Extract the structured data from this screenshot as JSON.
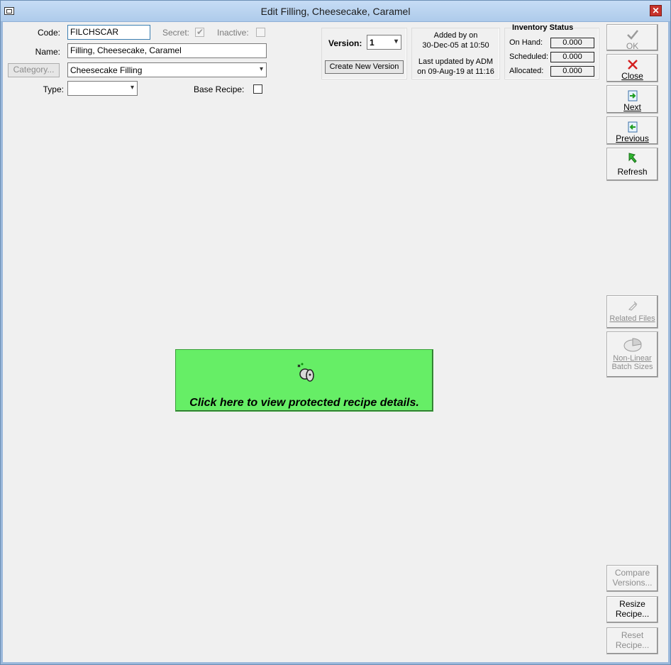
{
  "window": {
    "title": "Edit Filling, Cheesecake, Caramel"
  },
  "form": {
    "code_label": "Code:",
    "code_value": "FILCHSCAR",
    "secret_label": "Secret:",
    "inactive_label": "Inactive:",
    "name_label": "Name:",
    "name_value": "Filling, Cheesecake, Caramel",
    "category_button": "Category...",
    "category_value": "Cheesecake Filling",
    "type_label": "Type:",
    "type_value": "",
    "base_recipe_label": "Base Recipe:"
  },
  "version": {
    "label": "Version:",
    "value": "1",
    "create_button": "Create New Version"
  },
  "audit": {
    "added_line1": "Added by  on",
    "added_line2": "30-Dec-05 at 10:50",
    "updated_line1": "Last updated by ADM",
    "updated_line2": "on 09-Aug-19 at 11:16"
  },
  "inventory": {
    "title": "Inventory Status",
    "on_hand_label": "On Hand:",
    "on_hand_value": "0.000",
    "scheduled_label": "Scheduled:",
    "scheduled_value": "0.000",
    "allocated_label": "Allocated:",
    "allocated_value": "0.000"
  },
  "side": {
    "ok": "OK",
    "close": "Close",
    "next": "Next",
    "previous": "Previous",
    "refresh": "Refresh",
    "related_files": "Related Files",
    "non_linear_line1": "Non-Linear",
    "non_linear_line2": "Batch Sizes",
    "compare_line1": "Compare",
    "compare_line2": "Versions...",
    "resize_line1": "Resize",
    "resize_line2": "Recipe...",
    "reset_line1": "Reset",
    "reset_line2": "Recipe..."
  },
  "protected": {
    "message": "Click here to view protected recipe details."
  },
  "colors": {
    "banner": "#66ee66",
    "close_red": "#c7322b",
    "titlebar": "#aecbeb"
  }
}
